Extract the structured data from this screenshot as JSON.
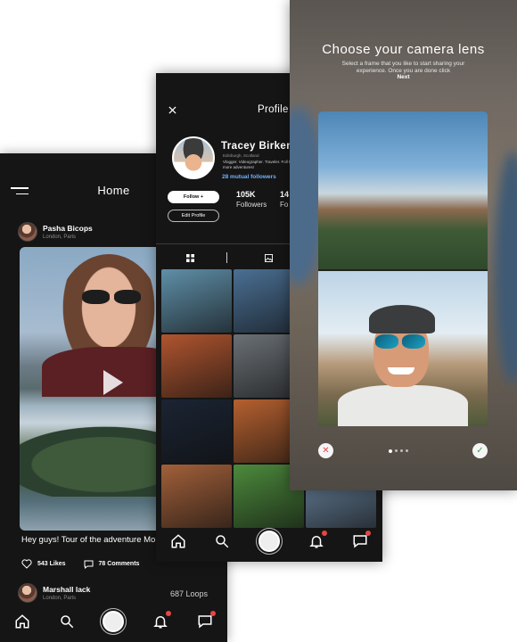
{
  "home": {
    "title": "Home",
    "post1": {
      "name": "Pasha Bicops",
      "location": "London, Paris"
    },
    "caption": "Hey guys! Tour of the adventure Mountains today!",
    "likes": "543 Likes",
    "comments": "78 Comments",
    "post2": {
      "name": "Marshall lack",
      "location": "London, Paris"
    },
    "loops": "687 Loops"
  },
  "profile": {
    "title": "Profile",
    "name": "Tracey Birkenst",
    "location": "Edinburgh, Scotland",
    "bio": "Vlogger. Videographer. Traveler. Foll Follow more more adventures!",
    "mutual": "28 mutual followers",
    "follow_label": "Follow +",
    "edit_label": "Edit Profile",
    "followers_count": "105K",
    "followers_label": "Followers",
    "following_count": "14",
    "following_label": "Fo",
    "photo_colors": [
      "#5f8fa8",
      "#4a6f93",
      "#2d3d47",
      "#b0552f",
      "#6a7075",
      "#2a2a2a",
      "#1b2433",
      "#b5602f",
      "#3a3a3a",
      "#a2603a",
      "#4c8a3c",
      "#6a85a0"
    ]
  },
  "lens": {
    "heading": "Choose your camera lens",
    "subtitle": "Select a frame that you like to start sharing your experience. Once you are done click",
    "next": "Next",
    "reject_glyph": "✕",
    "accept_glyph": "✓"
  },
  "colors": {
    "badge": "#e84545",
    "mutual": "#6fb4ff",
    "accept": "#2fa84f",
    "reject": "#e04848"
  }
}
